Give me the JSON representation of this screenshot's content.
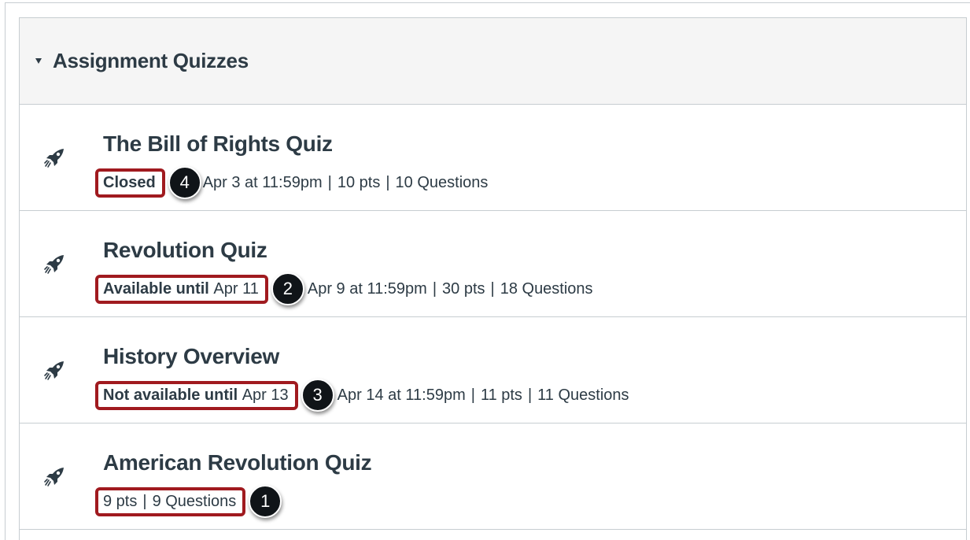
{
  "group": {
    "title": "Assignment Quizzes"
  },
  "quizzes": [
    {
      "title": "The Bill of Rights Quiz",
      "status_strong": "Closed",
      "status_date": "",
      "callout": "4",
      "due": "Apr 3 at 11:59pm",
      "points": "10 pts",
      "questions": "10 Questions"
    },
    {
      "title": "Revolution Quiz",
      "status_strong": "Available until",
      "status_date": "Apr 11",
      "callout": "2",
      "due": "Apr 9 at 11:59pm",
      "points": "30 pts",
      "questions": "18 Questions"
    },
    {
      "title": "History Overview",
      "status_strong": "Not available until",
      "status_date": "Apr 13",
      "callout": "3",
      "due": "Apr 14 at 11:59pm",
      "points": "11 pts",
      "questions": "11 Questions"
    },
    {
      "title": "American Revolution Quiz",
      "points": "9 pts",
      "questions": "9 Questions",
      "callout": "1"
    }
  ],
  "separator": "|",
  "icons": {
    "quiz_icon": "rocket-icon",
    "collapse_icon": "caret-down-icon"
  },
  "colors": {
    "highlight_border": "#a01a1f",
    "header_bg": "#f5f5f5",
    "text": "#2d3b45"
  }
}
